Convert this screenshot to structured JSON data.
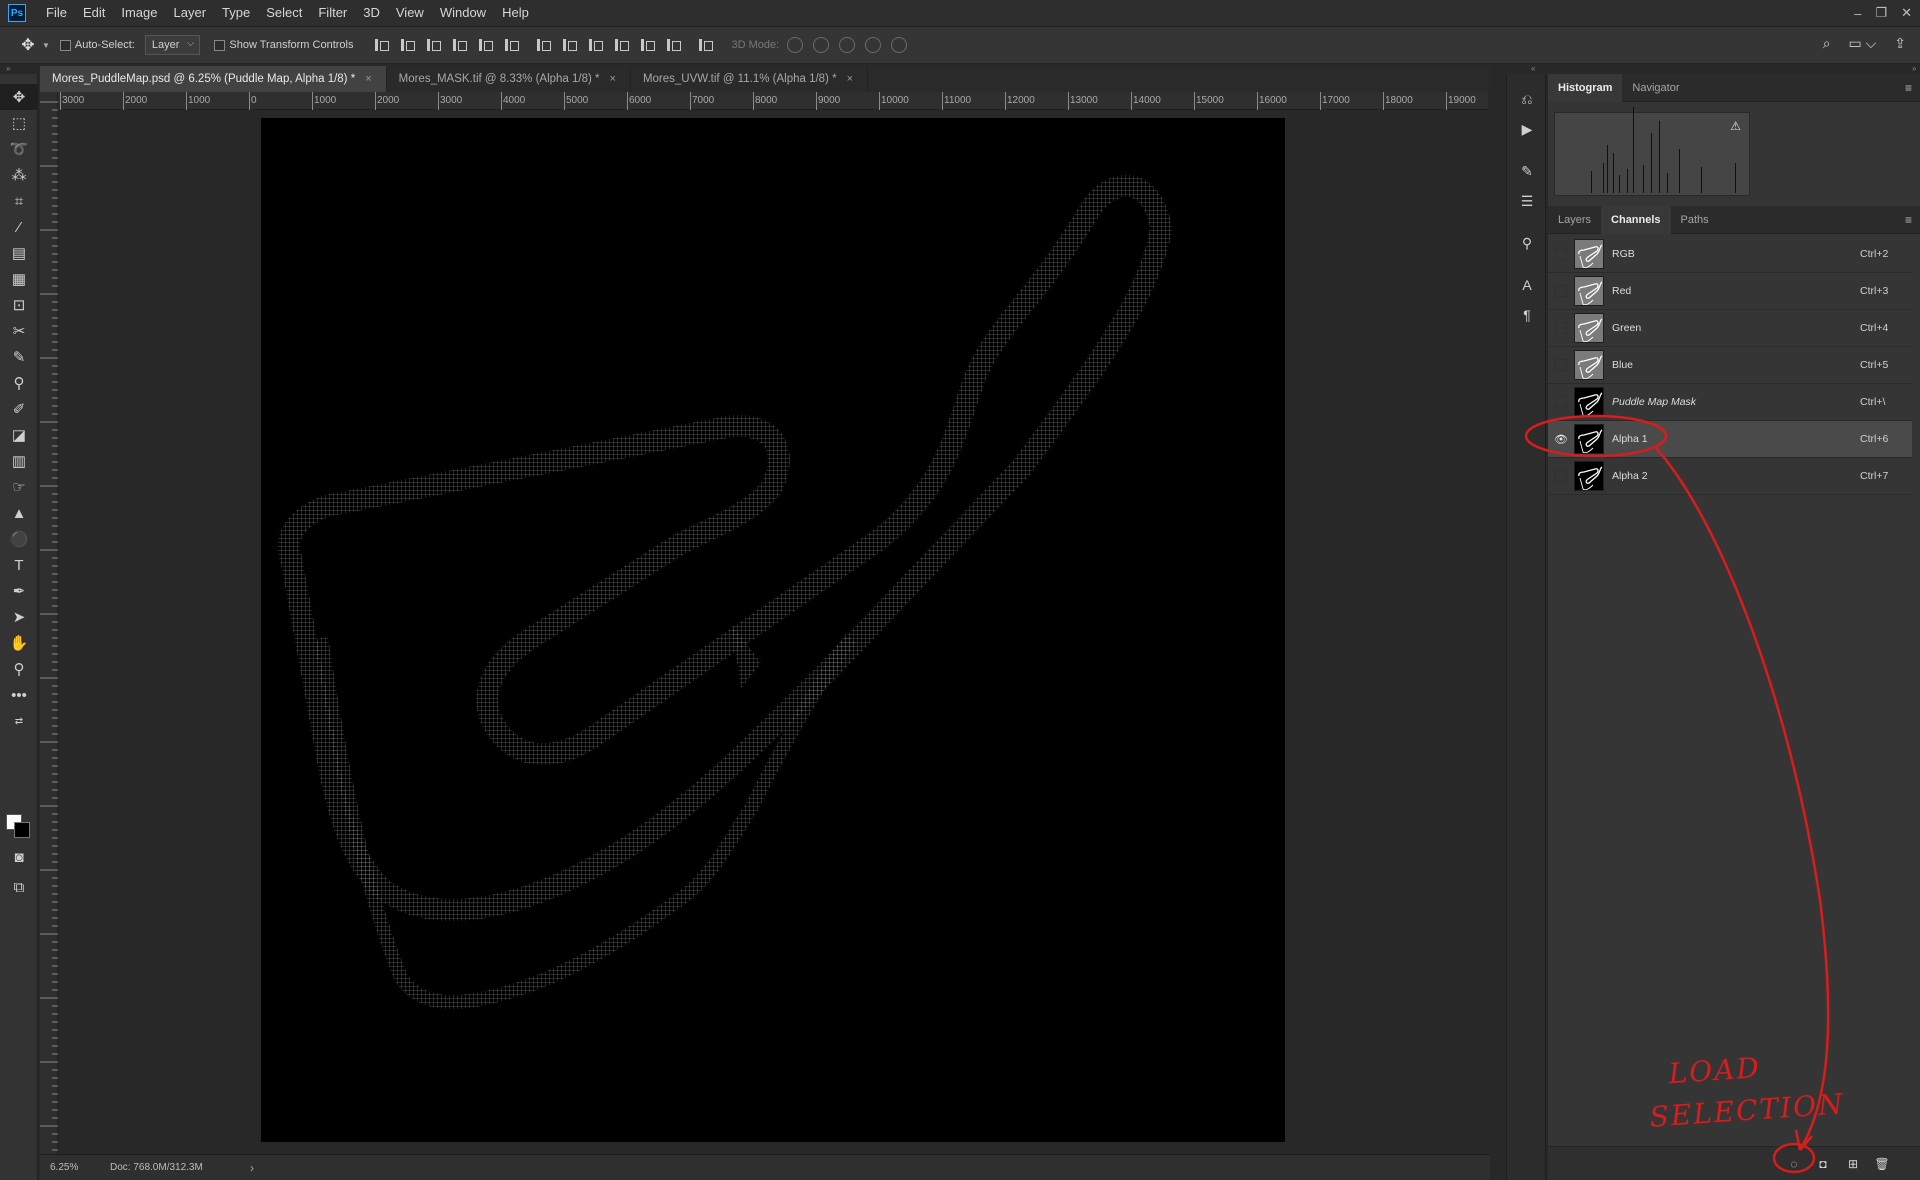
{
  "app": {
    "logo_text": "Ps",
    "menu": [
      "File",
      "Edit",
      "Image",
      "Layer",
      "Type",
      "Select",
      "Filter",
      "3D",
      "View",
      "Window",
      "Help"
    ],
    "window_controls": [
      "–",
      "❐",
      "✕"
    ]
  },
  "options_bar": {
    "auto_select_label": "Auto-Select:",
    "auto_select_value": "Layer",
    "show_transform_label": "Show Transform Controls",
    "mode_3d_label": "3D Mode:"
  },
  "document_tabs": [
    {
      "label": "Mores_PuddleMap.psd @ 6.25% (Puddle Map, Alpha 1/8) *",
      "active": true
    },
    {
      "label": "Mores_MASK.tif @ 8.33% (Alpha 1/8) *",
      "active": false
    },
    {
      "label": "Mores_UVW.tif @ 11.1% (Alpha 1/8) *",
      "active": false
    }
  ],
  "ruler": {
    "top_labels": [
      "3000",
      "2000",
      "1000",
      "0",
      "1000",
      "2000",
      "3000",
      "4000",
      "5000",
      "6000",
      "7000",
      "8000",
      "9000",
      "10000",
      "11000",
      "12000",
      "13000",
      "14000",
      "15000",
      "16000",
      "17000",
      "18000",
      "19000"
    ]
  },
  "status_bar": {
    "zoom": "6.25%",
    "doc_info": "Doc: 768.0M/312.3M"
  },
  "histogram_panel": {
    "tabs": [
      "Histogram",
      "Navigator"
    ],
    "warning_icon": "⚠"
  },
  "channels_panel": {
    "tabs": [
      "Layers",
      "Channels",
      "Paths"
    ],
    "channels": [
      {
        "name": "RGB",
        "shortcut": "Ctrl+2",
        "visible": false,
        "thumb": "light",
        "italic": false
      },
      {
        "name": "Red",
        "shortcut": "Ctrl+3",
        "visible": false,
        "thumb": "light",
        "italic": false
      },
      {
        "name": "Green",
        "shortcut": "Ctrl+4",
        "visible": false,
        "thumb": "light",
        "italic": false
      },
      {
        "name": "Blue",
        "shortcut": "Ctrl+5",
        "visible": false,
        "thumb": "light",
        "italic": false
      },
      {
        "name": "Puddle Map Mask",
        "shortcut": "Ctrl+\\",
        "visible": false,
        "thumb": "dark",
        "italic": true
      },
      {
        "name": "Alpha 1",
        "shortcut": "Ctrl+6",
        "visible": true,
        "thumb": "dark",
        "italic": false
      },
      {
        "name": "Alpha 2",
        "shortcut": "Ctrl+7",
        "visible": false,
        "thumb": "dark",
        "italic": false
      }
    ]
  },
  "annotation": {
    "line1": "LOAD",
    "line2": "SELECTION",
    "color": "#d91c1c"
  },
  "colors": {
    "foreground": "#ffffff",
    "background": "#000000",
    "accent": "#31a8ff"
  }
}
